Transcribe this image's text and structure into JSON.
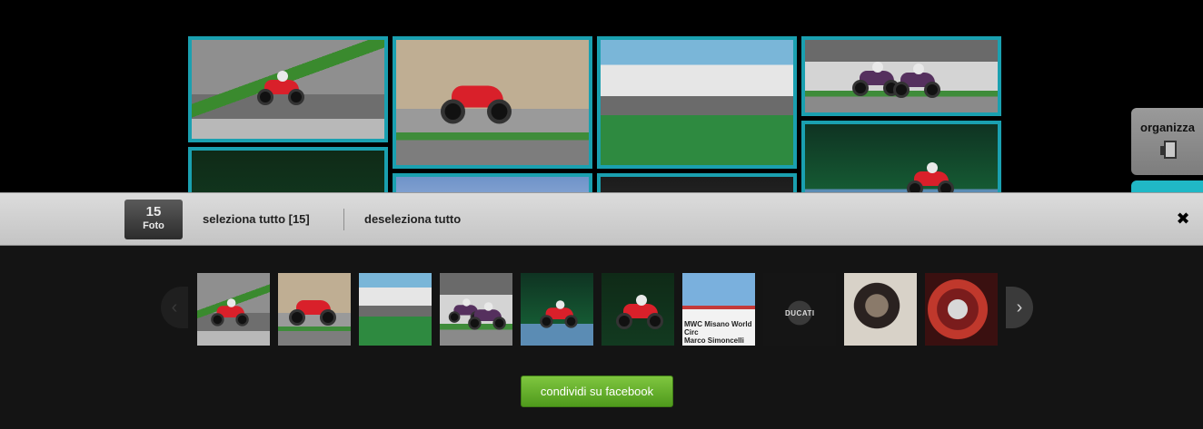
{
  "organizer": {
    "label": "organizza",
    "icon": "organize-icon"
  },
  "toolbar": {
    "count_number": "15",
    "count_label": "Foto",
    "select_all": "seleziona tutto [15]",
    "deselect_all": "deseleziona tutto",
    "close_icon": "close-icon",
    "close_glyph": "✖"
  },
  "carousel": {
    "prev_glyph": "‹",
    "next_glyph": "›",
    "thumbnail_count": 10,
    "banner_text": "MWC Misano World Circ",
    "banner_subtext": "Marco Simoncelli",
    "engine_text": "DUCATI"
  },
  "share": {
    "facebook_label": "condividi su facebook"
  },
  "colors": {
    "tile_border": "#1aa0b0",
    "accent_teal": "#20b8c6",
    "button_green": "#5faf2b"
  }
}
